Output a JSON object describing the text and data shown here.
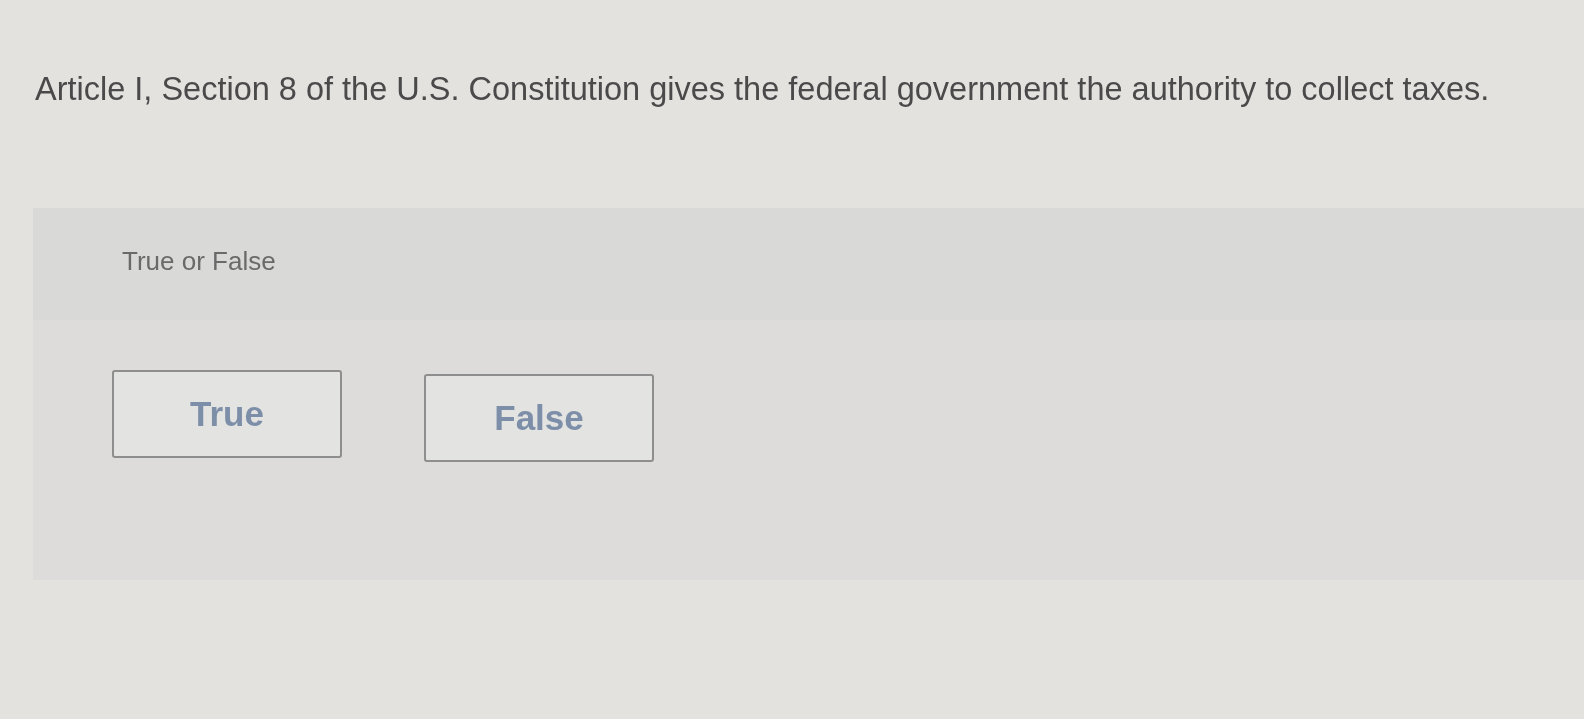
{
  "question": {
    "text": "Article I, Section 8 of the U.S. Constitution gives the federal government the authority to collect taxes."
  },
  "answer_panel": {
    "prompt": "True or False",
    "options": [
      {
        "label": "True"
      },
      {
        "label": "False"
      }
    ]
  }
}
